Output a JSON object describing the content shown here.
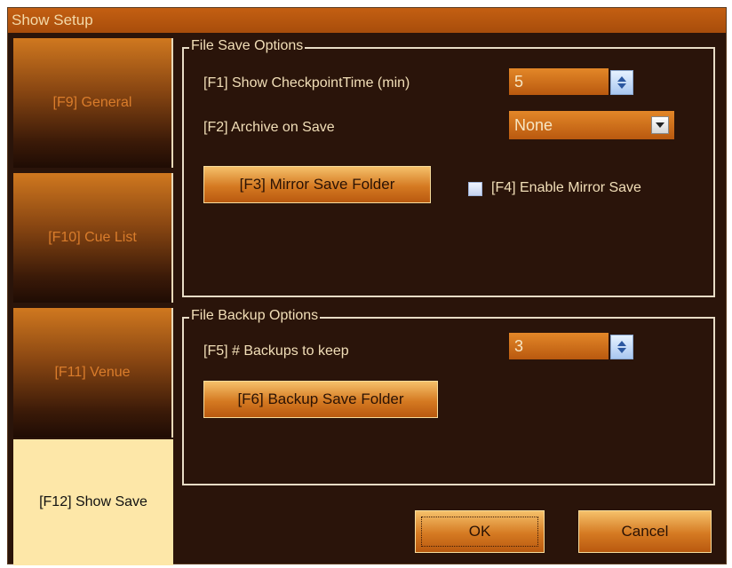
{
  "window": {
    "title": "Show Setup"
  },
  "sidebar": {
    "tabs": [
      {
        "label": "[F9] General"
      },
      {
        "label": "[F10] Cue List"
      },
      {
        "label": "[F11] Venue"
      },
      {
        "label": "[F12] Show Save",
        "active": true
      }
    ]
  },
  "file_save": {
    "title": "File Save Options",
    "checkpoint_label": "[F1] Show CheckpointTime (min)",
    "checkpoint_value": "5",
    "archive_label": "[F2] Archive on Save",
    "archive_value": "None",
    "mirror_button": "[F3] Mirror Save Folder",
    "enable_mirror_label": "[F4] Enable Mirror Save",
    "enable_mirror_checked": false
  },
  "file_backup": {
    "title": "File Backup Options",
    "backups_label": "[F5] # Backups to keep",
    "backups_value": "3",
    "backup_button": "[F6] Backup Save Folder"
  },
  "footer": {
    "ok": "OK",
    "cancel": "Cancel"
  },
  "colors": {
    "window_bg": "#2a140a",
    "titlebar": "#b85510",
    "active_tab": "#fde7a8",
    "text": "#f2dfb8"
  }
}
